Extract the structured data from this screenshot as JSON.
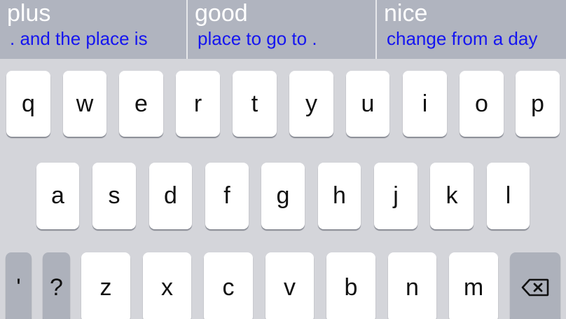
{
  "suggestions": [
    {
      "word": "plus",
      "phrase": ". and the place is"
    },
    {
      "word": "good",
      "phrase": "place to go to ."
    },
    {
      "word": "nice",
      "phrase": "change from a day"
    }
  ],
  "keyboard": {
    "row1": [
      "q",
      "w",
      "e",
      "r",
      "t",
      "y",
      "u",
      "i",
      "o",
      "p"
    ],
    "row2": [
      "a",
      "s",
      "d",
      "f",
      "g",
      "h",
      "j",
      "k",
      "l"
    ],
    "row3": {
      "apostrophe": "'",
      "question": "?",
      "letters": [
        "z",
        "x",
        "c",
        "v",
        "b",
        "n",
        "m"
      ],
      "backspace_icon": "backspace-icon"
    }
  },
  "colors": {
    "suggest_bar": "#b0b4bf",
    "suggest_word": "#ffffff",
    "suggest_phrase": "#1515f0",
    "keyboard_bg": "#d4d5da",
    "key": "#ffffff",
    "key_dark": "#adb1bb"
  }
}
